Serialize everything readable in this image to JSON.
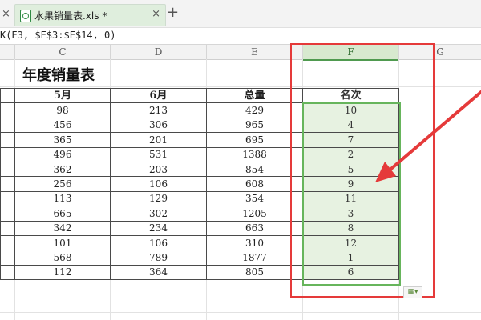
{
  "tabbar": {
    "left_close": "×",
    "file_title": "水果销量表.xls *",
    "tab_close": "×",
    "new_tab": "+"
  },
  "formula_bar": {
    "text": "K(E3, $E$3:$E$14, 0)"
  },
  "columns": [
    "C",
    "D",
    "E",
    "F",
    "G"
  ],
  "sheet": {
    "title": "年度销量表",
    "headers": {
      "may": "5月",
      "jun": "6月",
      "total": "总量",
      "rank": "名次"
    },
    "rows": [
      [
        "98",
        "213",
        "429",
        "10"
      ],
      [
        "456",
        "306",
        "965",
        "4"
      ],
      [
        "365",
        "201",
        "695",
        "7"
      ],
      [
        "496",
        "531",
        "1388",
        "2"
      ],
      [
        "362",
        "203",
        "854",
        "5"
      ],
      [
        "256",
        "106",
        "608",
        "9"
      ],
      [
        "113",
        "129",
        "354",
        "11"
      ],
      [
        "665",
        "302",
        "1205",
        "3"
      ],
      [
        "342",
        "234",
        "663",
        "8"
      ],
      [
        "101",
        "106",
        "310",
        "12"
      ],
      [
        "568",
        "789",
        "1877",
        "1"
      ],
      [
        "112",
        "364",
        "805",
        "6"
      ]
    ]
  },
  "icons": {
    "file": "spreadsheet-file-icon",
    "autofill": "autofill-options-icon"
  },
  "colors": {
    "selection": "#67b55c",
    "annotation": "#e53a3a",
    "rank_fill": "#e7f2e1"
  }
}
